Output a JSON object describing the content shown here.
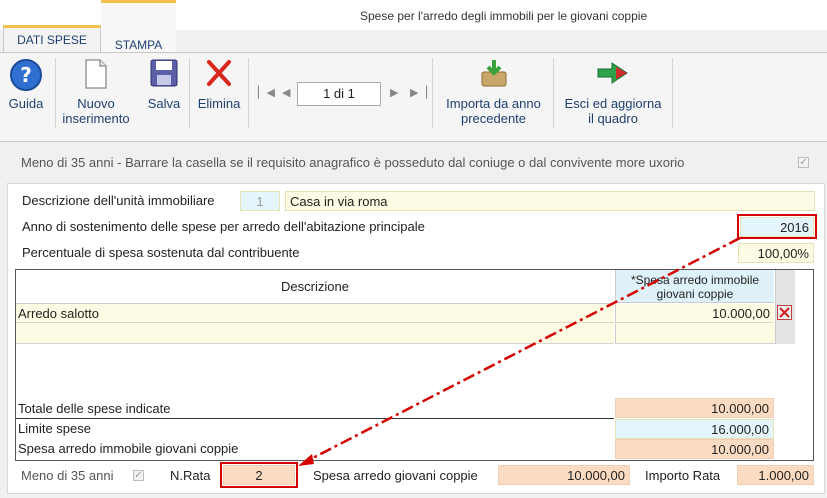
{
  "window": {
    "title": "Spese per l'arredo degli immobili per le giovani coppie"
  },
  "tabs": [
    {
      "label": "DATI SPESE"
    },
    {
      "label": "STAMPA"
    }
  ],
  "toolbar": {
    "guida": "Guida",
    "nuovo_l1": "Nuovo",
    "nuovo_l2": "inserimento",
    "salva": "Salva",
    "elimina": "Elimina",
    "page_indicator": "1 di 1",
    "importa_l1": "Importa da anno",
    "importa_l2": "precedente",
    "esci_l1": "Esci ed aggiorna",
    "esci_l2": "il quadro"
  },
  "requirement": {
    "text": "Meno di 35 anni - Barrare la casella se il requisito anagrafico è posseduto dal coniuge o dal convivente more uxorio",
    "checked": true
  },
  "form": {
    "descrizione_label": "Descrizione dell'unità immobiliare",
    "unit_number": "1",
    "unit_description": "Casa in via roma",
    "anno_label": "Anno di sostenimento delle spese per arredo dell'abitazione principale",
    "anno_value": "2016",
    "percentuale_label": "Percentuale di spesa sostenuta dal contribuente",
    "percentuale_value": "100,00%"
  },
  "table": {
    "col_descrizione": "Descrizione",
    "col_spesa_l1": "*Spesa arredo immobile",
    "col_spesa_l2": "giovani coppie",
    "rows": [
      {
        "descrizione": "Arredo salotto",
        "importo": "10.000,00"
      }
    ],
    "totale_label": "Totale delle spese indicate",
    "totale_value": "10.000,00",
    "limite_label": "Limite spese",
    "limite_value": "16.000,00",
    "spesa_label": "Spesa arredo immobile giovani coppie",
    "spesa_value": "10.000,00"
  },
  "footer": {
    "meno35_label": "Meno di 35 anni",
    "meno35_checked": true,
    "nrata_label": "N.Rata",
    "nrata_value": "2",
    "spesa_label": "Spesa arredo giovani coppie",
    "spesa_value": "10.000,00",
    "importo_label": "Importo Rata",
    "importo_value": "1.000,00"
  },
  "colors": {
    "highlight_red": "#d40000",
    "tab_accent": "#f2c14e",
    "field_yellow": "#fdfbe3",
    "field_orange": "#fbdcc2",
    "field_blue": "#e4f6fb"
  }
}
